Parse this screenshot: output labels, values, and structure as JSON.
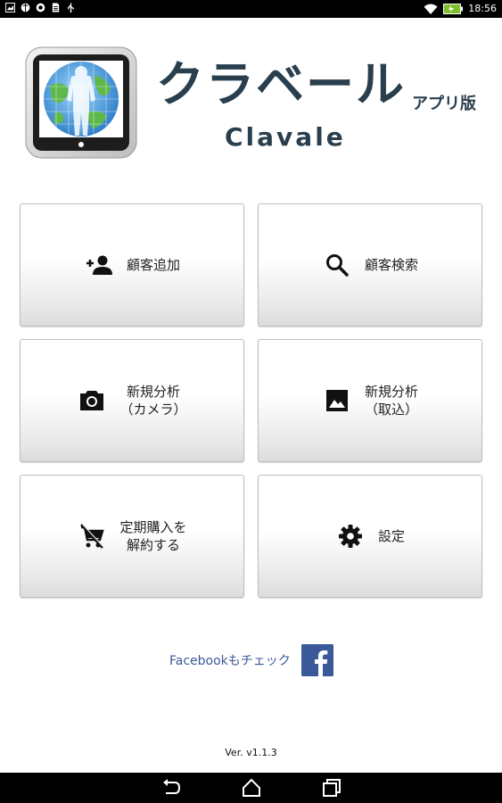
{
  "status_bar": {
    "time": "18:56",
    "left_icons": [
      "gallery-icon",
      "browser-icon",
      "asus-icon",
      "document-icon",
      "usb-icon"
    ],
    "right_icons": [
      "wifi-icon",
      "battery-icon"
    ]
  },
  "header": {
    "app_title": "クラベール",
    "app_subtitle": "アプリ版",
    "app_name_en": "Clavale"
  },
  "menu": {
    "add_customer": "顧客追加",
    "search_customer": "顧客検索",
    "new_analysis_camera": "新規分析\n（カメラ）",
    "new_analysis_import": "新規分析\n（取込）",
    "cancel_subscription": "定期購入を\n解約する",
    "settings": "設定"
  },
  "facebook": {
    "label": "Facebookもチェック"
  },
  "footer": {
    "version": "Ver. v1.1.3"
  },
  "colors": {
    "title": "#2a3f4d",
    "facebook": "#3b5998"
  }
}
